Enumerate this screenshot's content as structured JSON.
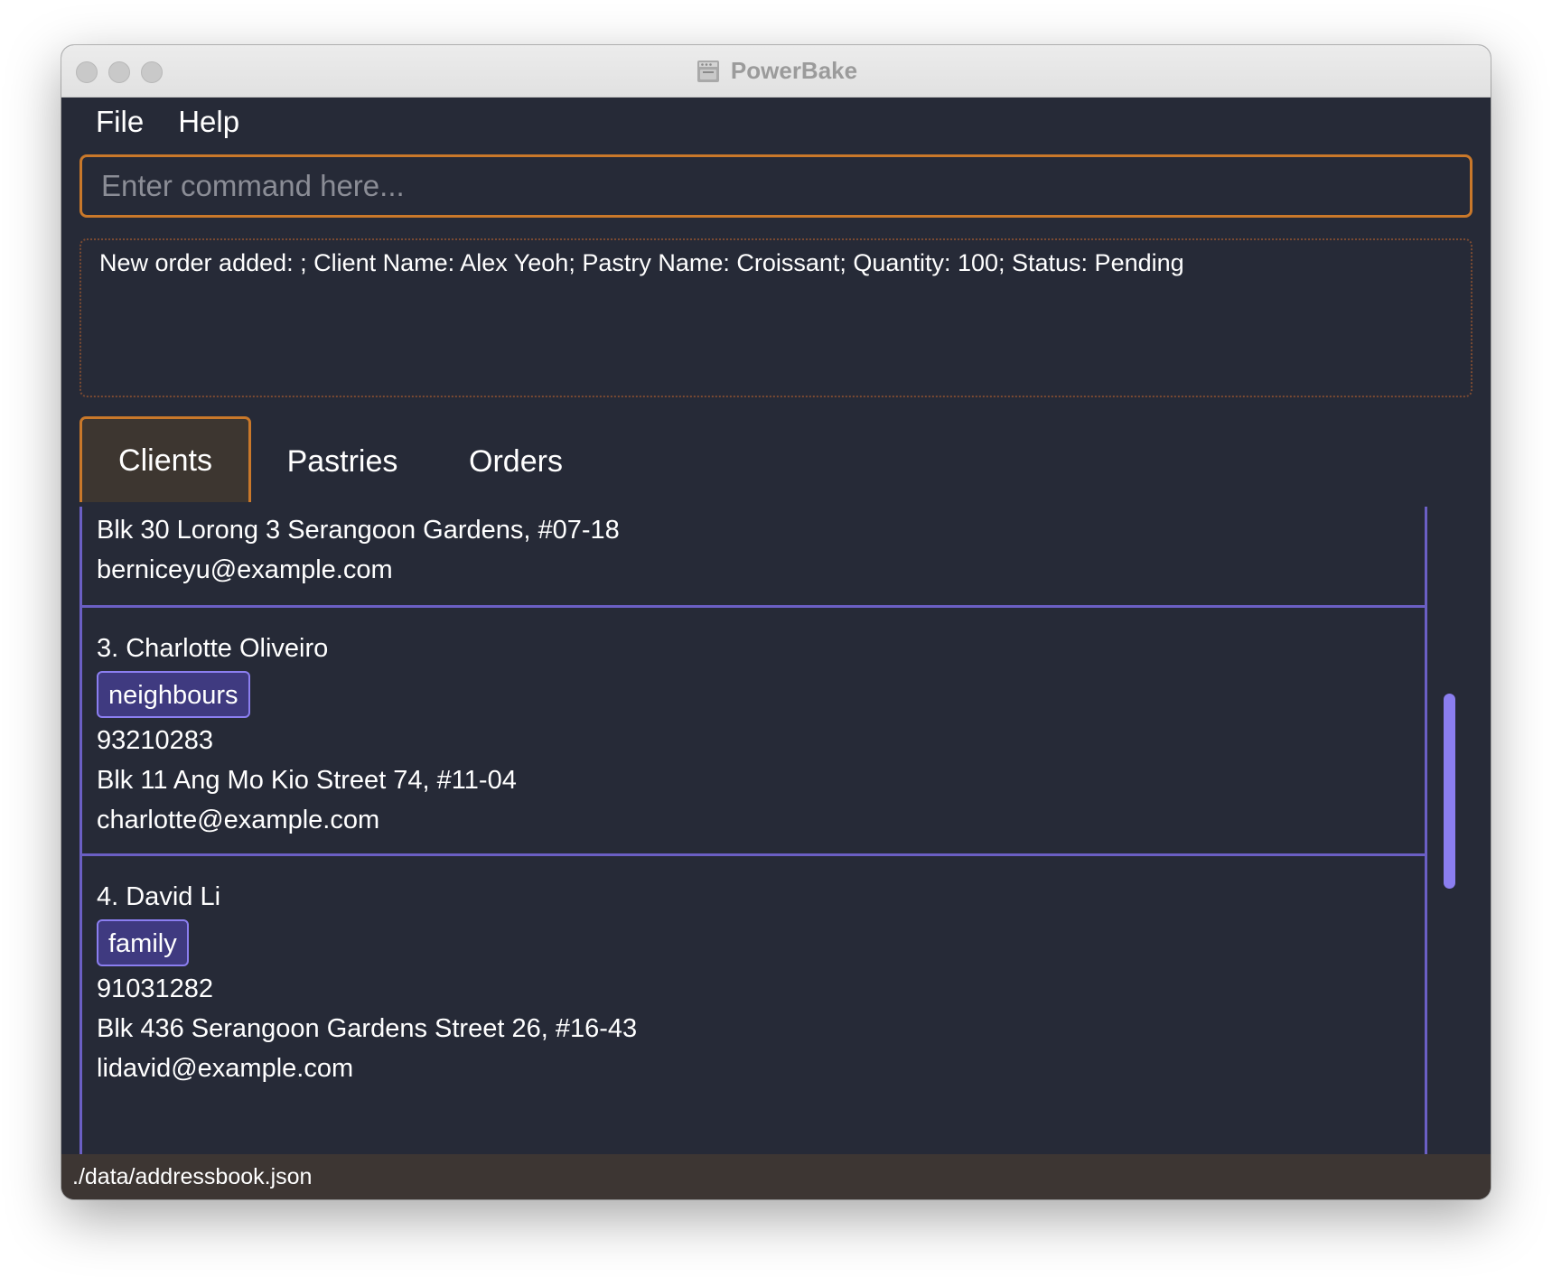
{
  "window": {
    "title": "PowerBake",
    "icon": "oven-icon"
  },
  "menu": {
    "file": "File",
    "help": "Help"
  },
  "command": {
    "value": "",
    "placeholder": "Enter command here..."
  },
  "result": {
    "text": "New order added: ; Client Name: Alex Yeoh; Pastry Name: Croissant; Quantity: 100; Status: Pending"
  },
  "tabs": [
    {
      "label": "Clients",
      "active": true
    },
    {
      "label": "Pastries",
      "active": false
    },
    {
      "label": "Orders",
      "active": false
    }
  ],
  "clients": [
    {
      "address": "Blk 30 Lorong 3 Serangoon Gardens, #07-18",
      "email": "berniceyu@example.com"
    },
    {
      "name": "3. Charlotte Oliveiro",
      "tag": "neighbours",
      "phone": "93210283",
      "address": "Blk 11 Ang Mo Kio Street 74, #11-04",
      "email": "charlotte@example.com"
    },
    {
      "name": "4. David Li",
      "tag": "family",
      "phone": "91031282",
      "address": "Blk 436 Serangoon Gardens Street 26, #16-43",
      "email": "lidavid@example.com"
    }
  ],
  "status": {
    "path": "./data/addressbook.json"
  },
  "colors": {
    "background": "#262a37",
    "accent_orange": "#c9782a",
    "accent_purple": "#8b7ef0",
    "tag_fill": "#3f3a80",
    "status_bar": "#3d3633"
  }
}
